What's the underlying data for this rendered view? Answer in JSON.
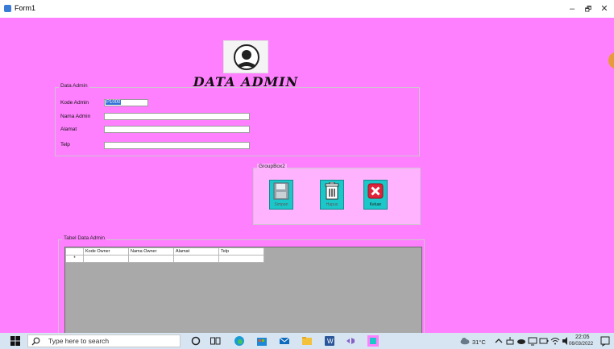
{
  "window": {
    "title": "Form1",
    "min": "–",
    "max": "🗗",
    "close": "✕"
  },
  "form": {
    "heading": "DATA ADMIN"
  },
  "data_admin": {
    "legend": "Data Admin",
    "fields": [
      {
        "label": "Kode Admin",
        "value": "P1000"
      },
      {
        "label": "Nama Admin",
        "value": ""
      },
      {
        "label": "Alamat",
        "value": ""
      },
      {
        "label": "Telp",
        "value": ""
      }
    ]
  },
  "groupbox2": {
    "legend": "GroupBox2",
    "buttons": [
      {
        "label": "Simpan",
        "icon": "floppy-disk-icon"
      },
      {
        "label": "Hapus",
        "icon": "trash-icon"
      },
      {
        "label": "Keluar",
        "icon": "close-x-icon"
      }
    ]
  },
  "table_group": {
    "legend": "Tabel Data Admin",
    "columns": [
      "",
      "Kode Owner",
      "Nama Owner",
      "Alamat",
      "Telp"
    ],
    "new_row_marker": "*"
  },
  "taskbar": {
    "search_placeholder": "Type here to search",
    "temperature": "31°C",
    "time": "22:05",
    "date": "06/03/2022"
  },
  "colors": {
    "form_background": "#ff80ff",
    "groupbox2_background": "#ffb3ff",
    "button_background": "#1cc7c9",
    "grid_background": "#a9a9a9"
  }
}
